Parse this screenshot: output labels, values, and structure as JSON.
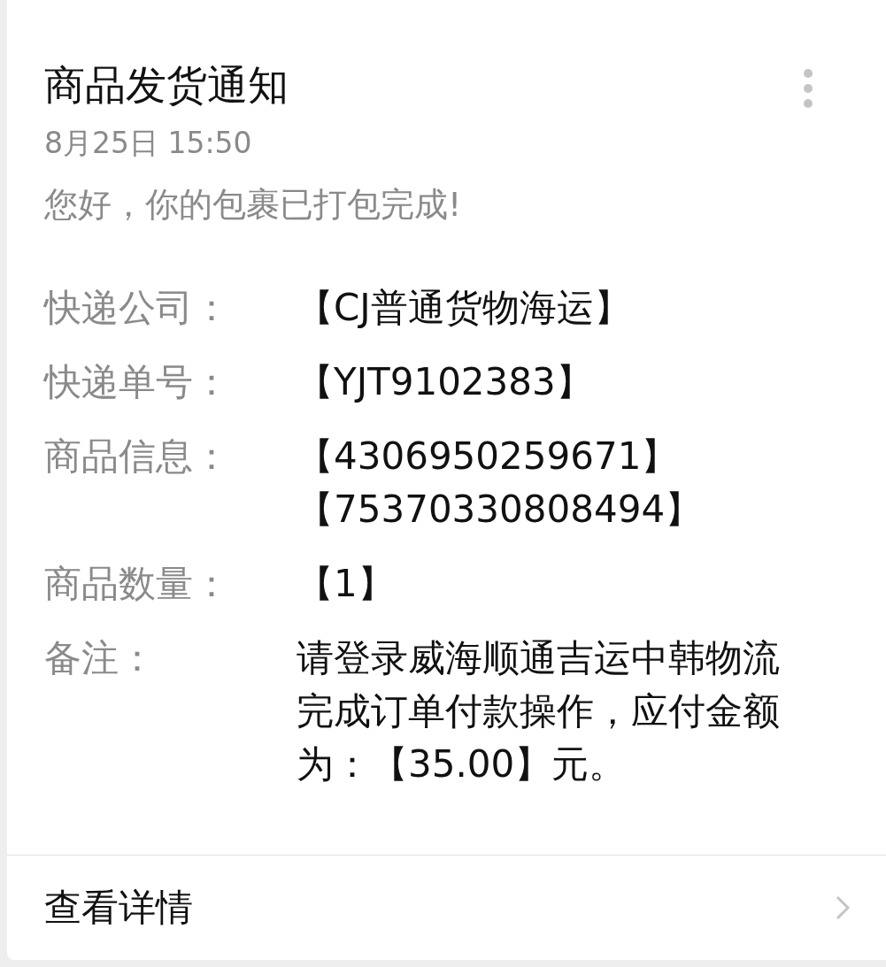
{
  "title": "商品发货通知",
  "time": "8月25日  15:50",
  "greeting": "您好，你的包裹已打包完成!",
  "rows": [
    {
      "label": "快递公司：",
      "lines": [
        "【CJ普通货物海运】"
      ]
    },
    {
      "label": "快递单号：",
      "lines": [
        "【YJT9102383】"
      ]
    },
    {
      "label": "商品信息：",
      "lines": [
        "【4306950259671】",
        "【75370330808494】"
      ]
    },
    {
      "label": "商品数量：",
      "lines": [
        "【1】"
      ]
    },
    {
      "label": "备注：",
      "lines": [
        "请登录威海顺通吉运中韩物流完成订单付款操作，应付金额为：【35.00】元。"
      ]
    }
  ],
  "footer": {
    "label": "查看详情"
  }
}
